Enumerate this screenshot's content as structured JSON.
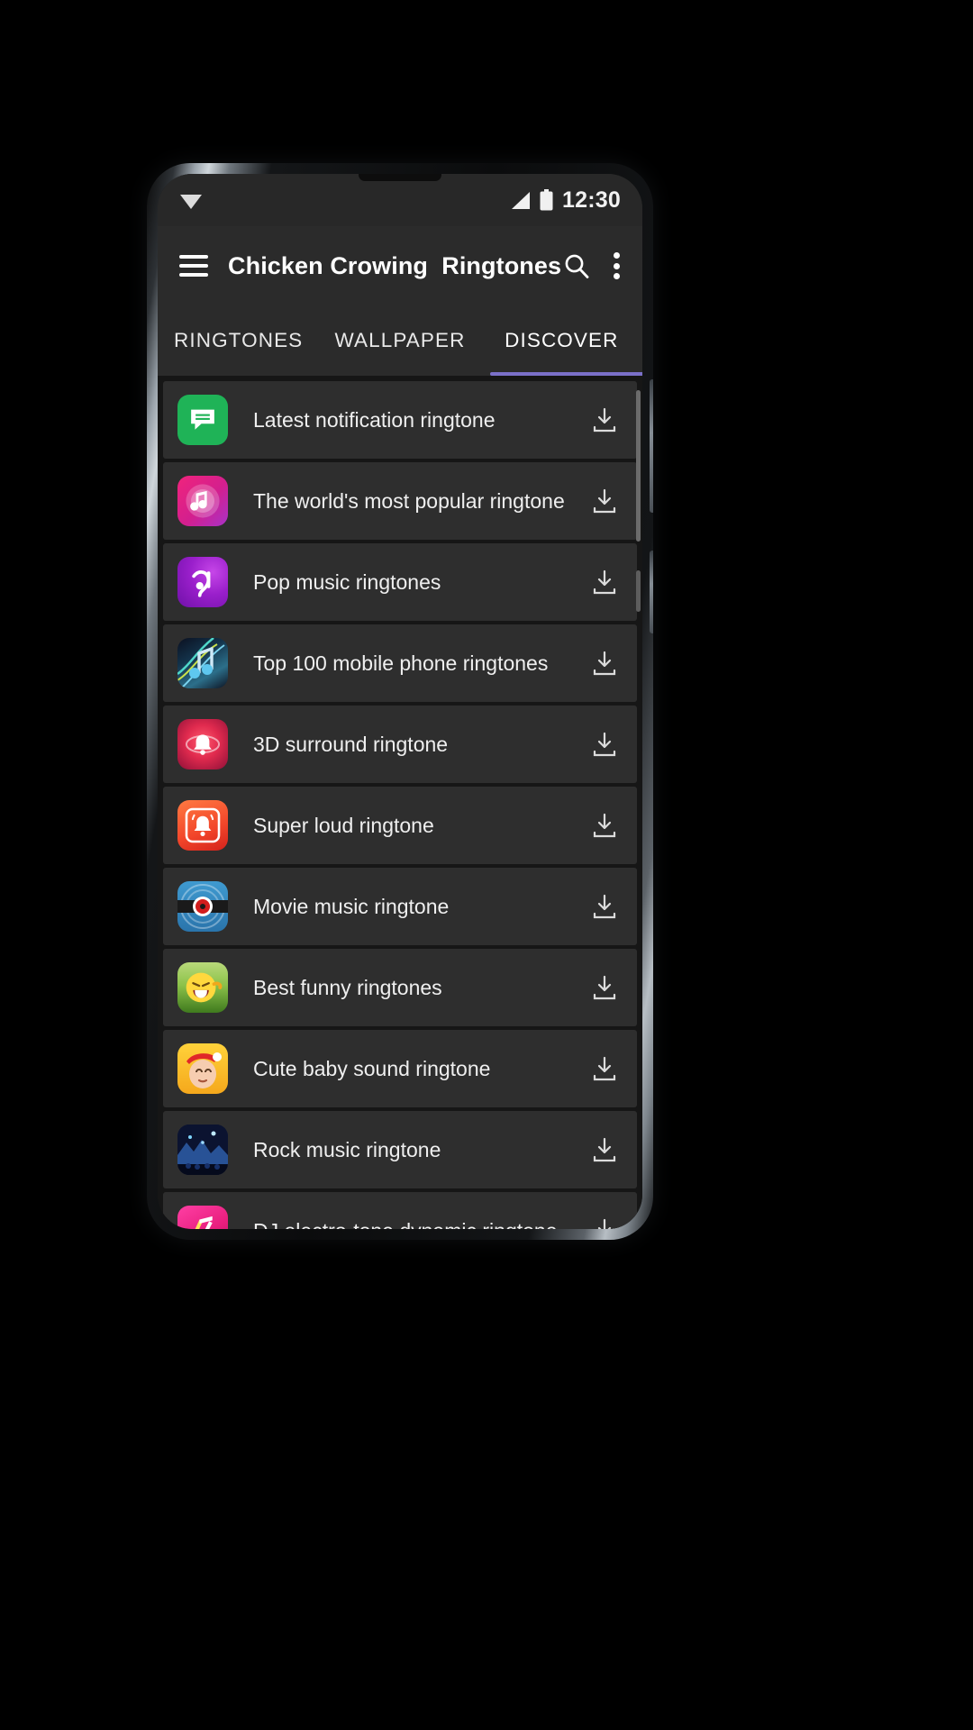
{
  "status_bar": {
    "time": "12:30",
    "wifi_icon": "wifi-icon",
    "signal_icon": "signal-icon",
    "battery_icon": "battery-icon"
  },
  "app_bar": {
    "menu_icon": "hamburger-menu-icon",
    "title": "Chicken Crowing  Ringtones",
    "search_icon": "search-icon",
    "overflow_icon": "more-vertical-icon"
  },
  "tabs": [
    {
      "label": "RINGTONES",
      "active": false
    },
    {
      "label": "WALLPAPER",
      "active": false
    },
    {
      "label": "DISCOVER",
      "active": true
    }
  ],
  "accent_color": "#7b70c9",
  "list": {
    "download_icon": "download-icon",
    "items": [
      {
        "label": "Latest notification ringtone",
        "icon": "chat-bubble-icon"
      },
      {
        "label": "The world's most popular ringtone",
        "icon": "music-note-circle-icon"
      },
      {
        "label": "Pop music ringtones",
        "icon": "music-swirl-icon"
      },
      {
        "label": "Top 100 mobile phone ringtones",
        "icon": "double-note-art-icon"
      },
      {
        "label": "3D surround ringtone",
        "icon": "bell-3d-icon"
      },
      {
        "label": "Super loud ringtone",
        "icon": "loud-bell-icon"
      },
      {
        "label": "Movie music ringtone",
        "icon": "film-reel-icon"
      },
      {
        "label": "Best funny ringtones",
        "icon": "laughing-emoji-icon"
      },
      {
        "label": "Cute baby sound ringtone",
        "icon": "baby-face-icon"
      },
      {
        "label": "Rock music ringtone",
        "icon": "rock-concert-icon"
      },
      {
        "label": "DJ electro-tone dynamic ringtone",
        "icon": "dj-note-icon"
      }
    ]
  }
}
